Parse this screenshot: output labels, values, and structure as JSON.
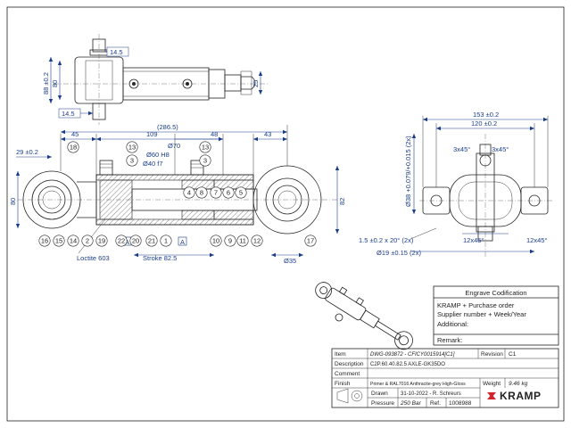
{
  "top_view": {
    "dims": [
      "14.5",
      "14.5",
      "88 ±0.2",
      "80",
      "25"
    ]
  },
  "section_view": {
    "dims": [
      "45",
      "109",
      "48",
      "43",
      "(286.5)",
      "29 ±0.2",
      "80",
      "82",
      "Ø70",
      "Ø60 H8",
      "Ø40 f7",
      "Ø35"
    ],
    "labels": [
      "A",
      "A",
      "Loctite 603",
      "Stroke 82.5"
    ],
    "balloons": [
      "18",
      "13",
      "3",
      "13",
      "3",
      "4",
      "8",
      "7",
      "6",
      "5",
      "16",
      "15",
      "14",
      "2",
      "19",
      "22",
      "20",
      "21",
      "1",
      "10",
      "9",
      "11",
      "12",
      "17"
    ]
  },
  "side_view": {
    "dims": [
      "153 ±0.2",
      "120 ±0.2",
      "3x45°",
      "3x45°",
      "Ø38 +0.079/+0.015 (2x)",
      "1.5 ±0.2 x 20° (2x)",
      "12x45°",
      "12x45°",
      "Ø19 ±0.15 (2x)"
    ]
  },
  "engrave": {
    "title": "Engrave Codification",
    "lines": [
      "KRAMP + Purchase order",
      "Supplier number + Week/Year",
      "Additional:"
    ],
    "remark": "Remark:"
  },
  "title_block": {
    "item_label": "Item",
    "item_value": "DWG-093872 - CFICY0015914[C1]",
    "revision_label": "Revision",
    "revision_value": "C1",
    "description_label": "Description",
    "description_value": "C2P.60.40.82.5 AXLE-GK35DO",
    "comment_label": "Comment",
    "finish_label": "Finish",
    "finish_value": "Primer & RAL7016 Anthracite-grey High-Gloss",
    "weight_label": "Weight",
    "weight_value": "9.46 kg",
    "drawn_label": "Drawn",
    "drawn_value": "31-10-2022 - R. Schreurs",
    "pressure_label": "Pressure",
    "pressure_value": "250 Bar",
    "ref_label": "Ref.",
    "ref_value": "1008988",
    "brand": "KRAMP"
  },
  "colors": {
    "dimension": "#1a3d8a",
    "line": "#222222",
    "brand_red": "#d2232a"
  }
}
